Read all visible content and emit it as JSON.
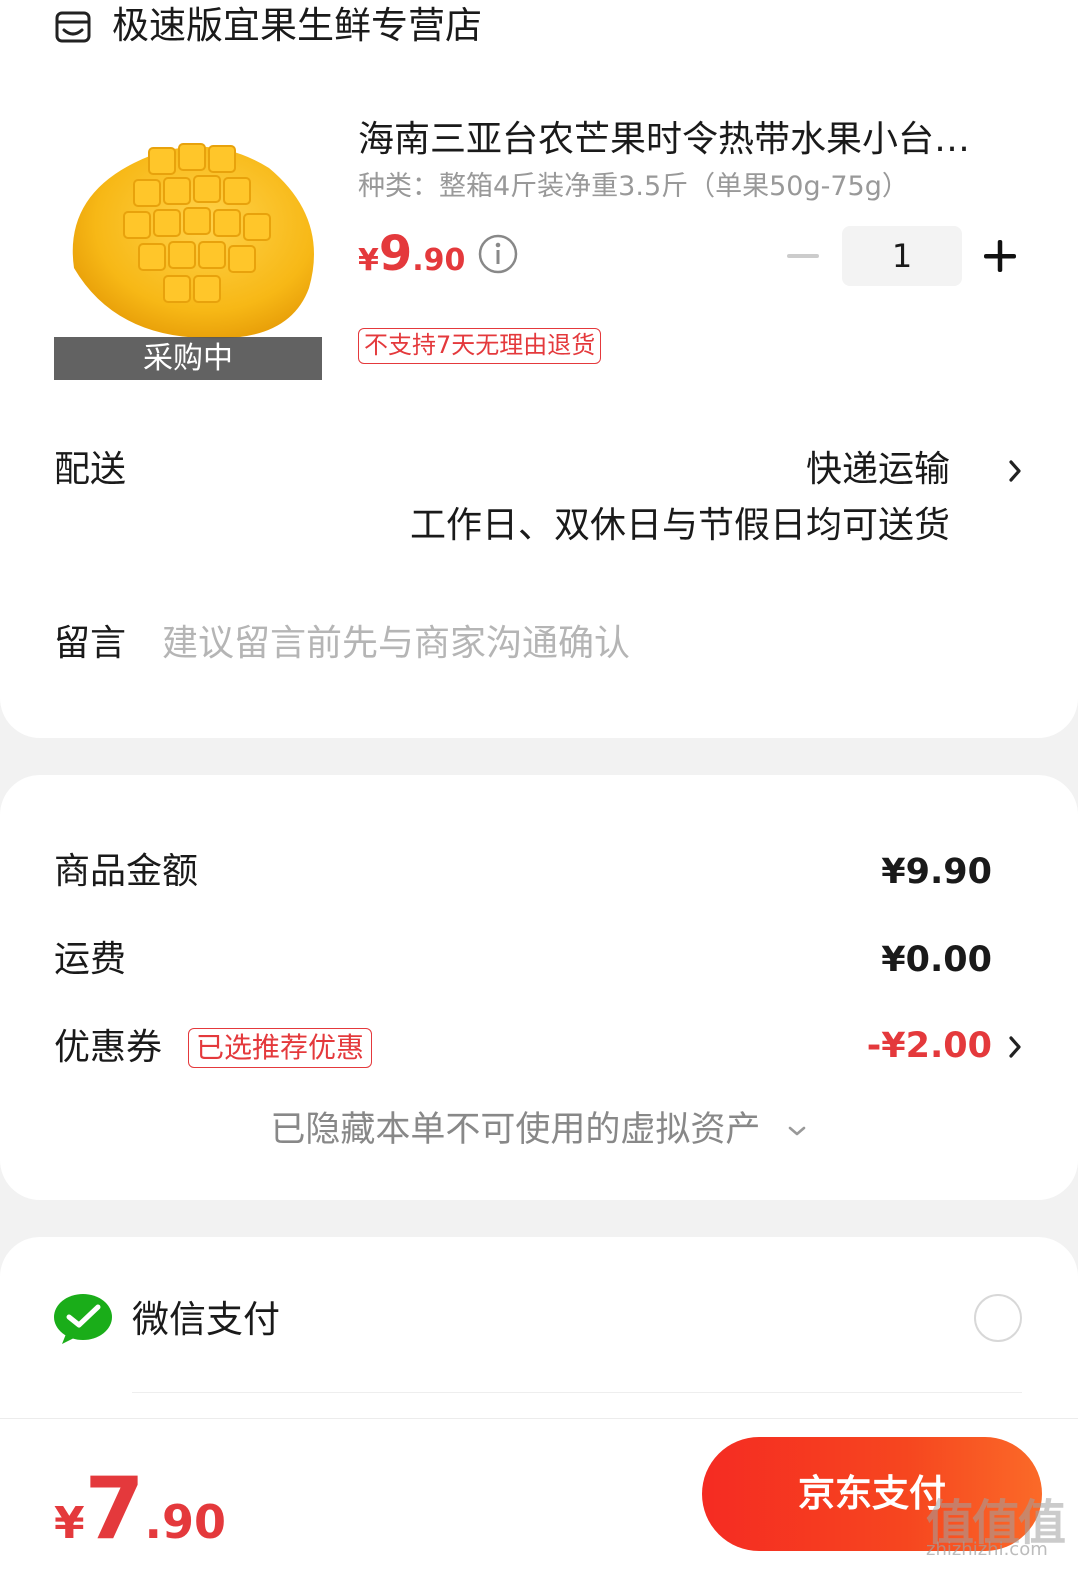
{
  "store": {
    "name": "极速版宜果生鲜专营店",
    "icon": "store-icon"
  },
  "product": {
    "image_badge": "采购中",
    "title": "海南三亚台农芒果时令热带水果小台…",
    "spec": "种类：整箱4斤装净重3.5斤（单果50g-75g）",
    "price_symbol": "¥",
    "price_integer": "9",
    "price_decimal": ".90",
    "quantity": "1",
    "return_policy": "不支持7天无理由退货"
  },
  "delivery": {
    "label": "配送",
    "method": "快递运输",
    "description": "工作日、双休日与节假日均可送货"
  },
  "message": {
    "label": "留言",
    "placeholder": "建议留言前先与商家沟通确认"
  },
  "summary": {
    "goods_label": "商品金额",
    "goods_amount": "¥9.90",
    "shipping_label": "运费",
    "shipping_amount": "¥0.00",
    "coupon_label": "优惠券",
    "coupon_tag": "已选推荐优惠",
    "coupon_amount": "-¥2.00",
    "hidden_assets": "已隐藏本单不可使用的虚拟资产"
  },
  "payment": {
    "wechat_label": "微信支付"
  },
  "footer": {
    "total_symbol": "¥",
    "total_integer": "7",
    "total_decimal": ".90",
    "pay_button": "京东支付",
    "watermark": "值值值",
    "watermark_sub": "zhizhizhi.com"
  },
  "colors": {
    "accent": "#e4393c",
    "wechat": "#1aad19"
  }
}
